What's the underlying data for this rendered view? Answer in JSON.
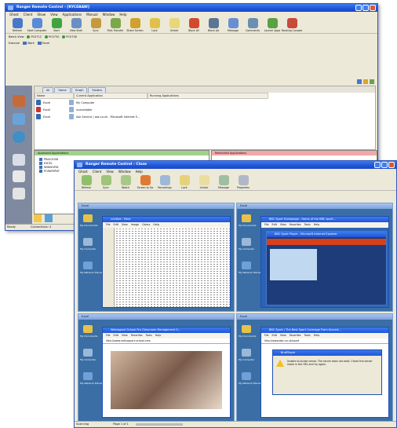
{
  "back_window": {
    "title": "Ranger Remote Control - [RYCEBAW]",
    "menu": [
      "Ghost",
      "Client",
      "Show",
      "View",
      "Applications",
      "Manual",
      "Window",
      "Help"
    ],
    "toolbar": [
      {
        "label": "Refresh",
        "icon": "refresh-icon",
        "color": "#4a78c8"
      },
      {
        "label": "Start Computer",
        "icon": "computer-icon",
        "color": "#5a8ad8"
      },
      {
        "label": "Start",
        "icon": "play-icon",
        "color": "#3fa43f"
      },
      {
        "label": "View Shell",
        "icon": "shell-icon",
        "color": "#6b8fc4"
      },
      {
        "label": "Sync",
        "icon": "sync-icon",
        "color": "#c59a3e"
      },
      {
        "label": "Files Transfer",
        "icon": "files-icon",
        "color": "#7aa84a"
      },
      {
        "label": "Share Screen",
        "icon": "screen-icon",
        "color": "#d0a030"
      },
      {
        "label": "Lock",
        "icon": "lock-icon",
        "color": "#e1c04a"
      },
      {
        "label": "Unlock",
        "icon": "unlock-icon",
        "color": "#e7d77a"
      },
      {
        "label": "Block All",
        "icon": "block-icon",
        "color": "#d24a2e"
      },
      {
        "label": "Block Ad",
        "icon": "block-ad-icon",
        "color": "#5d7595"
      },
      {
        "label": "Message",
        "icon": "message-icon",
        "color": "#6a8fd0"
      },
      {
        "label": "Commands",
        "icon": "commands-icon",
        "color": "#6c8fb0"
      },
      {
        "label": "Launch Apps",
        "icon": "apps-icon",
        "color": "#5aa045"
      },
      {
        "label": "Ranking Console",
        "icon": "ranking-icon",
        "color": "#c74a3a"
      }
    ],
    "row1": {
      "label": "Batch View",
      "items": [
        "PC0712",
        "PC0730",
        "PC0738"
      ]
    },
    "row2": {
      "label": "Execute",
      "items": [
        "Work",
        "Excel"
      ]
    },
    "tabs": [
      "All",
      "Home",
      "Graph",
      "Folders"
    ],
    "columns": [
      "Name",
      "Current Application",
      "Running Applications"
    ],
    "rows": [
      {
        "name": "Excel",
        "app": "My Computer",
        "icon_color": "#2f6ab3"
      },
      {
        "name": "Excel",
        "app": "unavailable",
        "icon_color": "#c33"
      },
      {
        "name": "Excel",
        "app": "Ask Service | ask.co.uk - Microsoft Internet E...",
        "icon_color": "#2f6ab3"
      }
    ],
    "approved_label": "Approved Applications",
    "restricted_label": "Restricted Applications",
    "approved_items": [
      "PRAC2008",
      "EXCEL",
      "WINWORD",
      "POWERPNT"
    ],
    "status": {
      "left": "Ready",
      "right": "Connections: 4"
    }
  },
  "front_window": {
    "title": "Ranger Remote Control - Close",
    "menu": [
      "Ghost",
      "Client",
      "View",
      "Window",
      "Help"
    ],
    "toolbar": [
      {
        "label": "Refresh",
        "icon": "refresh-icon",
        "color": "#8fbf6a"
      },
      {
        "label": "Sync",
        "icon": "sync-icon",
        "color": "#9fc47a"
      },
      {
        "label": "Watch",
        "icon": "watch-icon",
        "color": "#a8c88a"
      },
      {
        "label": "Screen to Go",
        "icon": "screen-icon",
        "color": "#e07a30"
      },
      {
        "label": "Recordings",
        "icon": "record-icon",
        "color": "#9fb8d8"
      },
      {
        "label": "Lock",
        "icon": "lock-icon",
        "color": "#e6d27a"
      },
      {
        "label": "Unlock",
        "icon": "unlock-icon",
        "color": "#e9dea0"
      },
      {
        "label": "Message",
        "icon": "message-icon",
        "color": "#9fbfa0"
      },
      {
        "label": "Properties",
        "icon": "properties-icon",
        "color": "#b0b8c8"
      }
    ],
    "panes": [
      {
        "title": "Excel",
        "window_title": "untitled - Paint",
        "window_menu": [
          "File",
          "Edit",
          "View",
          "Image",
          "Colors",
          "Help"
        ]
      },
      {
        "title": "Excel",
        "window_title": "BBC Sport Homepage - Home of the BBC sport...",
        "window_menu": [
          "File",
          "Edit",
          "View",
          "Favorites",
          "Tools",
          "Help"
        ],
        "player_title": "BBC Sport Player - Microsoft Internet Explorer"
      },
      {
        "title": "Excel",
        "window_title": "Webappeal School Pro Classroom Management S...",
        "window_menu": [
          "File",
          "Edit",
          "View",
          "Favorites",
          "Tools",
          "Help"
        ],
        "address": "http://www.netsupport-school.com"
      },
      {
        "title": "Excel",
        "window_title": "BBC Sport | The Best Sport Coverage From Around...",
        "window_menu": [
          "File",
          "Edit",
          "View",
          "Favorites",
          "Tools",
          "Help"
        ],
        "dialog_title": "BrutPlayer",
        "dialog_text": "Unable to locate server. The server does not exist. Check the server name in the URL and try again.",
        "address": "http://www.bbc.co.uk/sport"
      }
    ],
    "desktop_labels": [
      "My Documents",
      "My Computer",
      "My Network Places"
    ],
    "status": {
      "left": "Scanning",
      "middle": "Page 1 of 1"
    }
  }
}
